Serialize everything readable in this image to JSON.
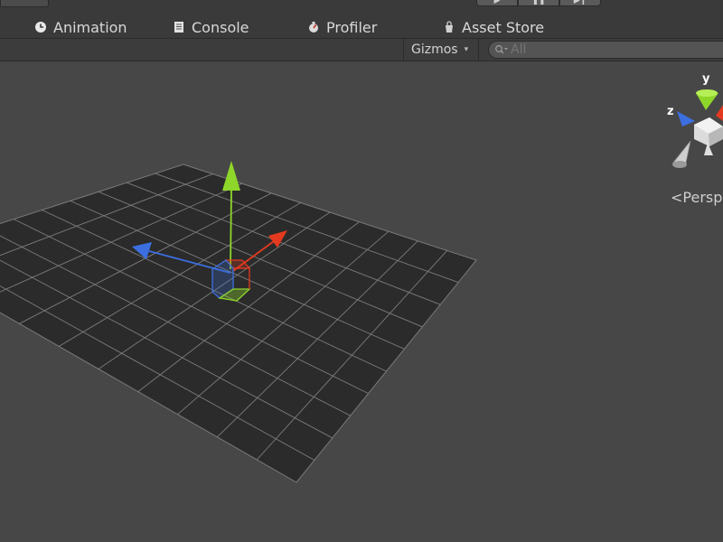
{
  "tabs": [
    {
      "label": "Animation",
      "icon": "clock-icon"
    },
    {
      "label": "Console",
      "icon": "console-icon"
    },
    {
      "label": "Profiler",
      "icon": "profiler-icon"
    },
    {
      "label": "Asset Store",
      "icon": "asset-store-icon"
    }
  ],
  "play_controls": {
    "play_icon": "▶",
    "pause_icon": "❚❚",
    "step_icon": "▶❙"
  },
  "scene_toolbar": {
    "gizmos_label": "Gizmos",
    "gizmos_caret": "▾",
    "search_placeholder": "All"
  },
  "orientation_gizmo": {
    "y_label": "y",
    "z_label": "z",
    "projection_label": "Persp",
    "projection_chevron": "<"
  },
  "colors": {
    "x_axis": "#e43a1f",
    "y_axis": "#8ed62a",
    "z_axis": "#3b6fe0",
    "grid_line": "#8a8a8a",
    "plane_fill": "#2b2b2b",
    "background": "#474747"
  }
}
